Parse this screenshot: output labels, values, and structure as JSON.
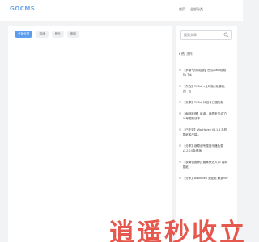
{
  "header": {
    "logo": "GOCMS",
    "nav": [
      "首页",
      "全部分类"
    ]
  },
  "main": {
    "tabs": [
      {
        "label": "全部分类",
        "active": true
      },
      {
        "label": "游戏"
      },
      {
        "label": "音乐"
      },
      {
        "label": "电脑"
      }
    ]
  },
  "sidebar": {
    "search_placeholder": "搜索文章",
    "hot_title": "♦ 热门排行",
    "hot_items": [
      "【梦模+仿网站版】西瓜/Jack视频Tik Tok",
      "【东西】TikTok ♥全球版♥免翻墙、去广告",
      "【安卓】TikTok 抖音今日国际版",
      "【幽默推荐】纸鸢，我再来加油了! 28号更新版本",
      "【已失效】WallHaven V4.1.4 手机壁纸客户端--",
      "【分享】我原创专属音乐器免费 v3.2.0.0免费版",
      "【表情包推荐】蜘蛛侠进入🕸️ 趣味壁纸",
      "【分享】wallhaven 无壁纸 解锁VIP"
    ],
    "watermark": "逍遥秒收立"
  }
}
